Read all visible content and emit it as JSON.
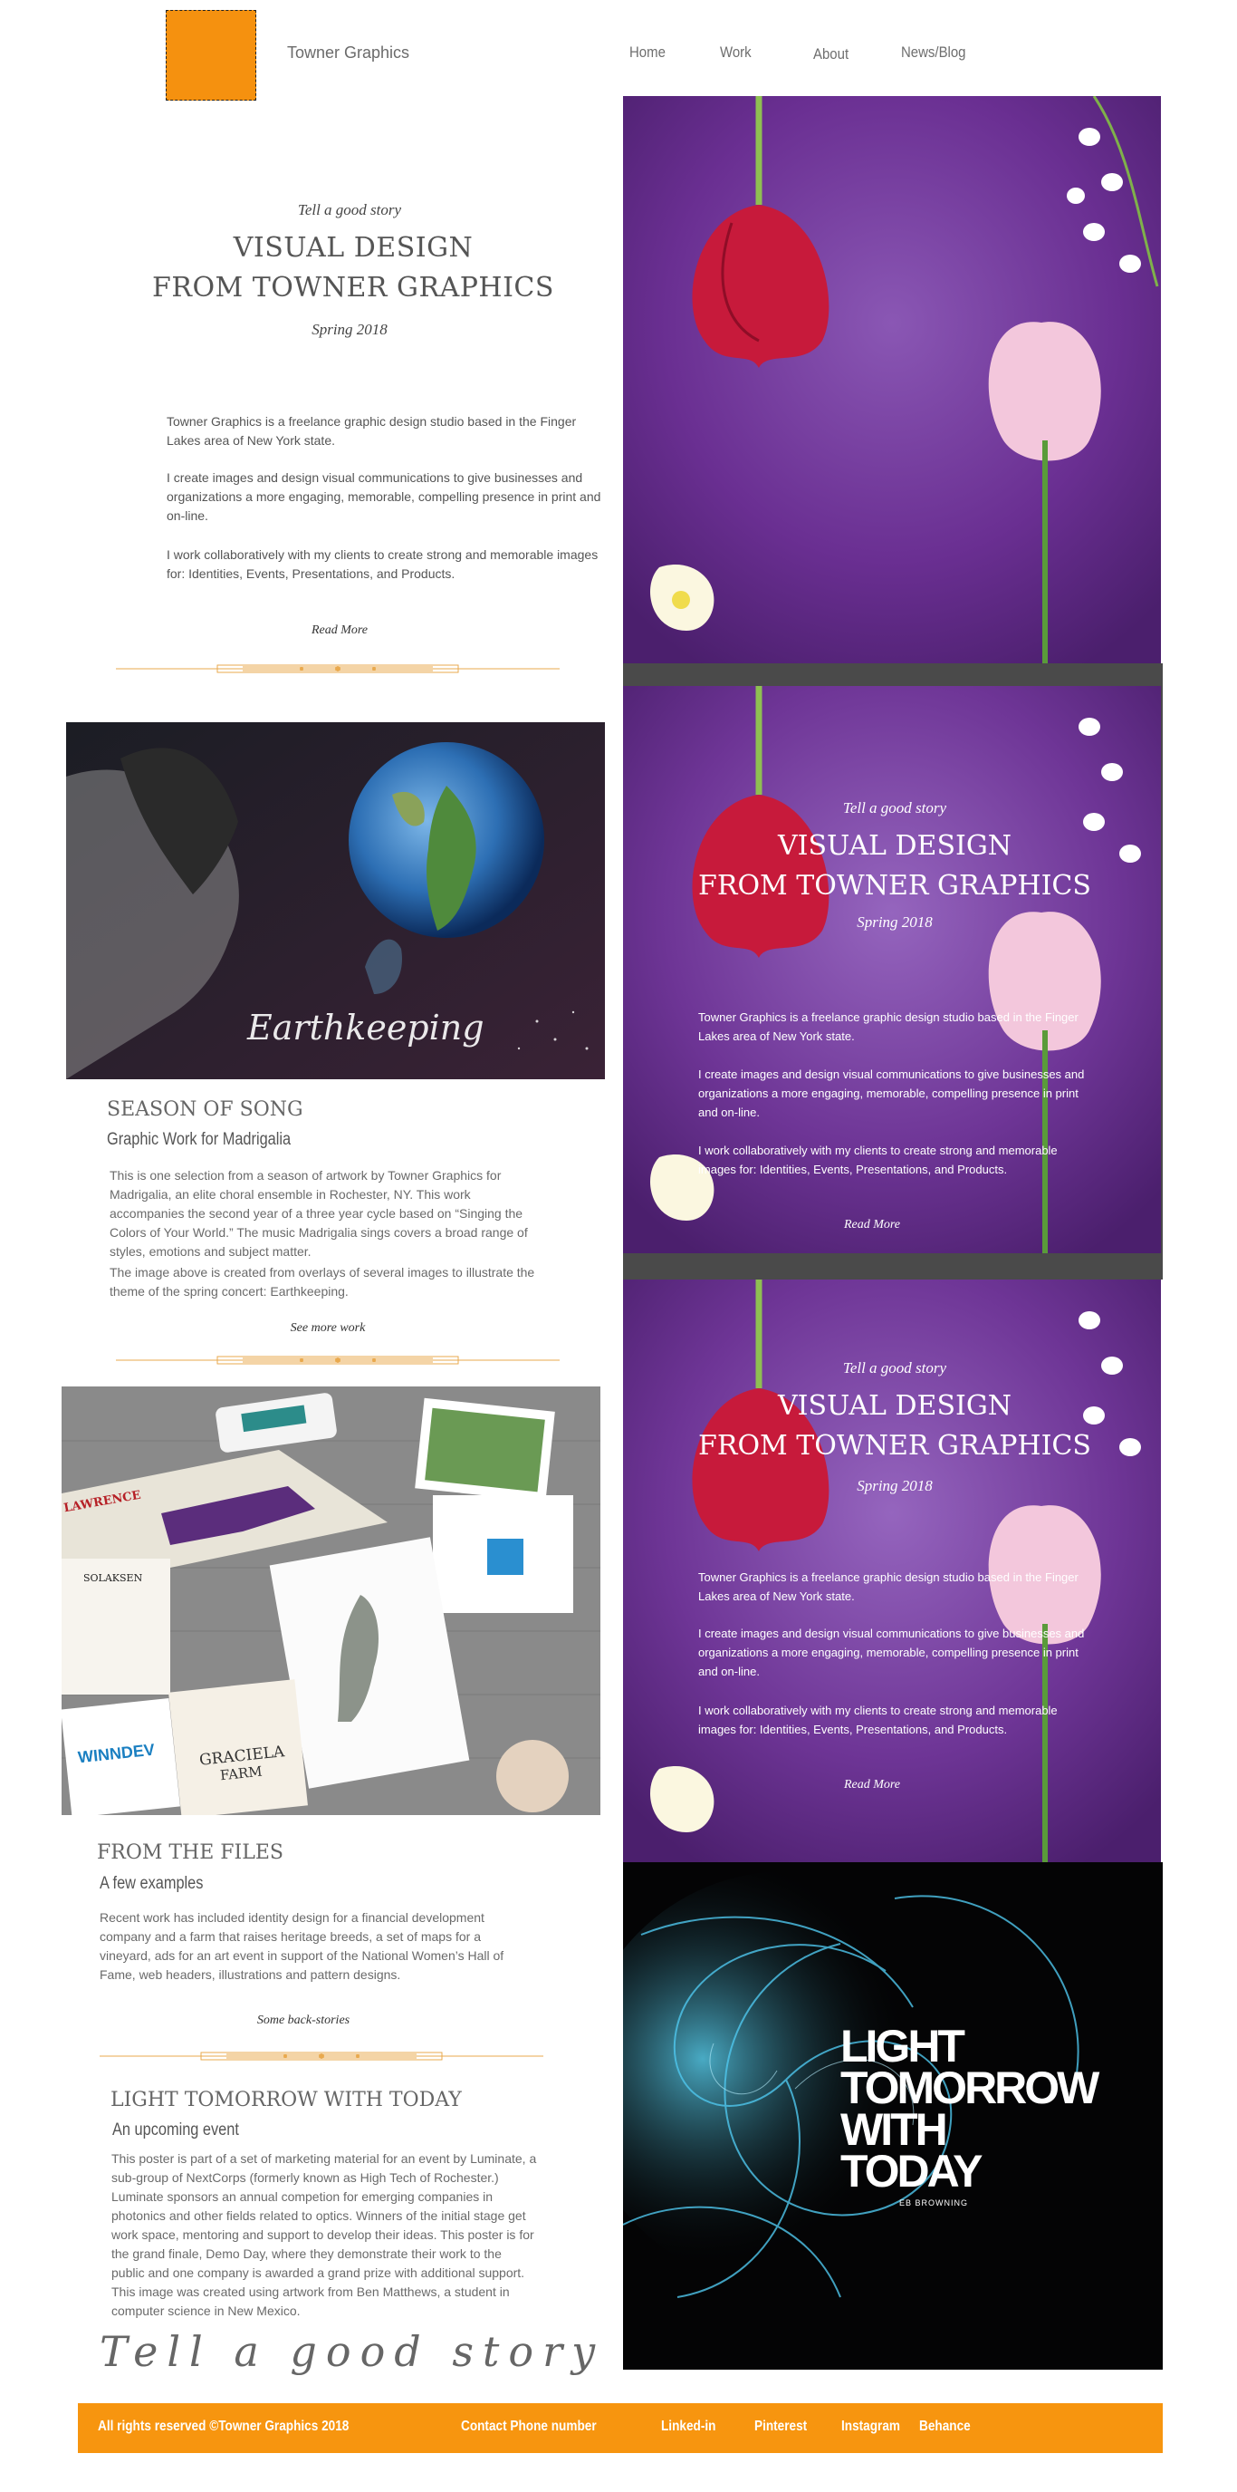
{
  "header": {
    "brand": "Towner Graphics",
    "nav": [
      "Home",
      "Work",
      "About",
      "News/Blog"
    ]
  },
  "hero": {
    "tagline": "Tell a good story",
    "title_line1": "VISUAL DESIGN",
    "title_line2": "FROM TOWNER GRAPHICS",
    "season": "Spring 2018",
    "para1": "Towner Graphics is a freelance graphic design studio based in the Finger Lakes area of New York state.",
    "para2": "I create images and design visual communications to give businesses and organizations a more engaging, memorable, compelling presence in print and on-line.",
    "para3": "I work collaboratively with my clients to create strong and memorable images for: Identities, Events, Presentations, and Products.",
    "read_more": "Read More"
  },
  "season_of_song": {
    "image_caption": "Earthkeeping",
    "title": "SEASON OF SONG",
    "subtitle": "Graphic Work for Madrigalia",
    "para1": "This is one selection from a season of artwork  by Towner Graphics for Madrigalia, an elite choral ensemble in Rochester, NY. This work accompanies the second year of a three year cycle based on “Singing the Colors of Your World.” The music Madrigalia sings covers a broad range of styles, emotions and subject matter.",
    "para2": "The image above is created from overlays of several images to illustrate the theme of the spring concert: Earthkeeping.",
    "link": "See more work"
  },
  "files": {
    "title": "FROM THE FILES",
    "subtitle": "A few examples",
    "para": "Recent work has included identity design for a financial development company and a farm that raises heritage breeds, a set of maps for a vineyard, ads for an art event in support of the National Women’s Hall of Fame, web headers, illustrations and pattern designs.",
    "link": "Some  back-stories",
    "mockup_labels": {
      "lawrence": "LAWRENCE",
      "solaksen": "SOLAKSEN",
      "winndev": "WINNDEV",
      "graciela1": "GRACIELA",
      "graciela2": "FARM"
    }
  },
  "light": {
    "title": "LIGHT TOMORROW WITH TODAY",
    "subtitle": "An upcoming event",
    "para": "This poster is part of a set of marketing material for an event by Luminate, a sub-group of NextCorps (formerly known as High Tech of Rochester.) Luminate sponsors an annual competion for emerging companies in photonics and other fields related to optics. Winners of the initial stage get work space, mentoring and support to develop their ideas. This poster is for the grand finale, Demo Day, where they demonstrate their work to the public and one company is awarded a grand prize with additional support. This image was created using artwork from Ben Matthews, a student in computer science in New Mexico.",
    "poster_line1": "LIGHT",
    "poster_line2": "TOMORROW",
    "poster_line3": "WITH",
    "poster_line4": "TODAY",
    "poster_credit": "EB BROWNING"
  },
  "script_tagline": "Tell a good story",
  "footer": {
    "copyright": "All rights reserved ©Towner Graphics 2018",
    "contact": "Contact Phone number",
    "links": [
      "Linked-in",
      "Pinterest",
      "Instagram",
      "Behance"
    ]
  },
  "colors": {
    "accent": "#f5910f",
    "purple": "#7a3fa0",
    "divider": "#e9a94e"
  }
}
